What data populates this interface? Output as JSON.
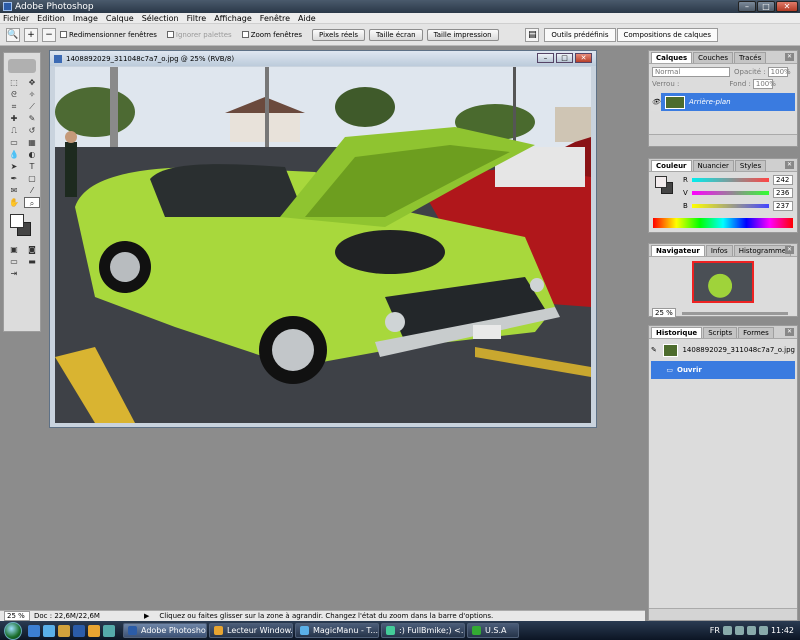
{
  "app": {
    "title": "Adobe Photoshop"
  },
  "menu": [
    "Fichier",
    "Edition",
    "Image",
    "Calque",
    "Sélection",
    "Filtre",
    "Affichage",
    "Fenêtre",
    "Aide"
  ],
  "options": {
    "resize_windows": "Redimensionner fenêtres",
    "ignore_palettes": "Ignorer palettes",
    "zoom_all": "Zoom fenêtres",
    "actual_pixels": "Pixels réels",
    "fit_screen": "Taille écran",
    "print_size": "Taille impression",
    "presets_tab": "Outils prédéfinis",
    "layer_comps_tab": "Compositions de calques"
  },
  "document": {
    "title": "1408892029_311048c7a7_o.jpg @ 25% (RVB/8)"
  },
  "layers_panel": {
    "tabs": [
      "Calques",
      "Couches",
      "Tracés"
    ],
    "blend_mode": "Normal",
    "opacity_label": "Opacité :",
    "opacity": "100%",
    "lock_label": "Verrou :",
    "fill_label": "Fond :",
    "fill": "100%",
    "layer_name": "Arrière-plan"
  },
  "color_panel": {
    "tabs": [
      "Couleur",
      "Nuancier",
      "Styles"
    ],
    "r_label": "R",
    "r": "242",
    "g_label": "V",
    "g": "236",
    "b_label": "B",
    "b": "237"
  },
  "navigator_panel": {
    "tabs": [
      "Navigateur",
      "Infos",
      "Histogramme"
    ],
    "zoom": "25 %"
  },
  "history_panel": {
    "tabs": [
      "Historique",
      "Scripts",
      "Formes"
    ],
    "snapshot": "1408892029_311048c7a7_o.jpg",
    "step": "Ouvrir"
  },
  "status": {
    "zoom": "25 %",
    "doc": "Doc : 22,6M/22,6M",
    "message": "Cliquez ou faites glisser sur la zone à agrandir. Changez l'état du zoom dans la barre d'options."
  },
  "taskbar": {
    "items": [
      "Adobe Photoshop",
      "Lecteur Window...",
      "MagicManu - T...",
      ":) FullBmike;) <...",
      "U.S.A"
    ],
    "clock": "11:42",
    "lang": "FR"
  }
}
